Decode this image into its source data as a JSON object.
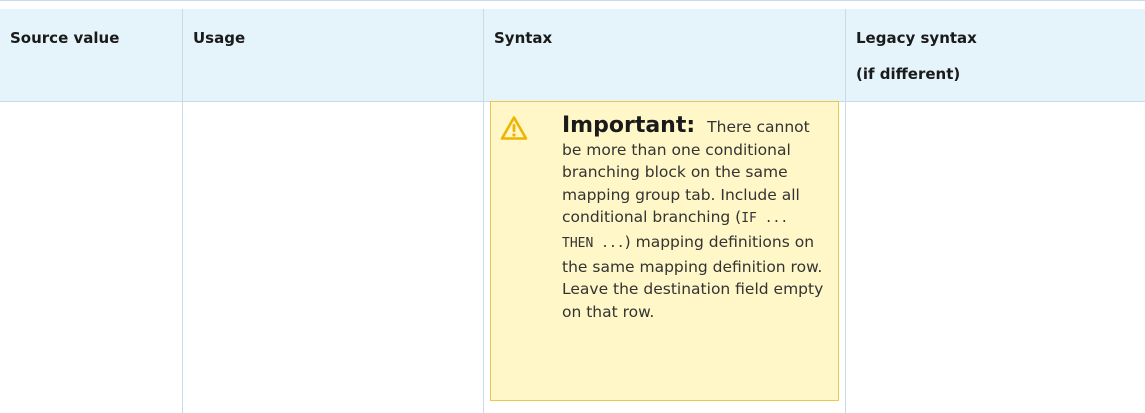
{
  "table": {
    "headers": [
      {
        "label": "Source value"
      },
      {
        "label": "Usage"
      },
      {
        "label": "Syntax"
      },
      {
        "label": "Legacy syntax",
        "label_line2": "(if different)"
      }
    ]
  },
  "callout": {
    "icon": "warning-triangle-icon",
    "title": "Important:",
    "text_part1": "There cannot be more than one conditional branching block on the same mapping group tab. Include all conditional branching (",
    "code": "IF ... THEN ...",
    "text_part2": ") mapping definitions on the same mapping definition row. Leave the destination field empty on that row.",
    "colors": {
      "background": "#fff7c7",
      "border": "#e6c94f",
      "icon": "#f0b400"
    }
  },
  "colors": {
    "header_background": "#e5f3fb",
    "grid_line": "#c7dbe9"
  }
}
